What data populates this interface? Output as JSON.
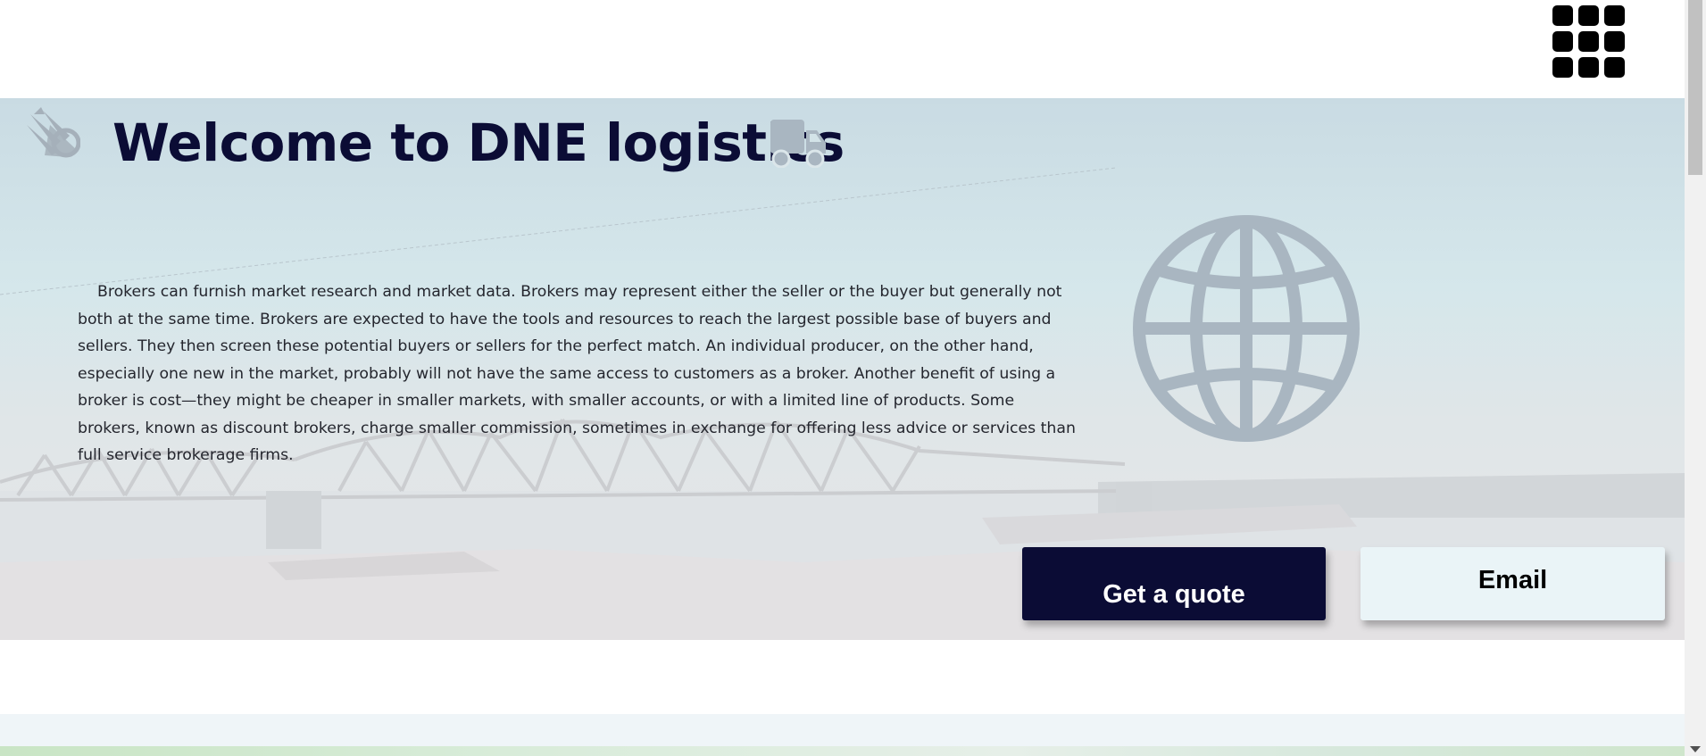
{
  "header": {
    "menu_icon": "grid-menu-icon"
  },
  "hero": {
    "logo_icon": "arrow-logo-icon",
    "title": "Welcome to DNE logistics",
    "truck_icon": "truck-icon",
    "globe_icon": "globe-icon",
    "description": "Brokers can furnish market research and market data. Brokers may represent either the seller or the buyer but generally not both at the same time. Brokers are expected to have the tools and resources to reach the largest possible base of buyers and sellers. They then screen these potential buyers or sellers for the perfect match. An individual producer, on the other hand, especially one new in the market, probably will not have the same access to customers as a broker. Another benefit of using a broker is cost—they might be cheaper in smaller markets, with smaller accounts, or with a limited line of products. Some brokers, known as discount brokers, charge smaller commission, sometimes in exchange for offering less advice or services than full service brokerage firms.",
    "quote_button": "Get a quote",
    "email_button": "Email"
  },
  "colors": {
    "title": "#0b0c35",
    "quote_button_bg": "#0b0c35",
    "email_button_bg": "#eaf4f7",
    "icon_gray": "#a9b6c1"
  }
}
